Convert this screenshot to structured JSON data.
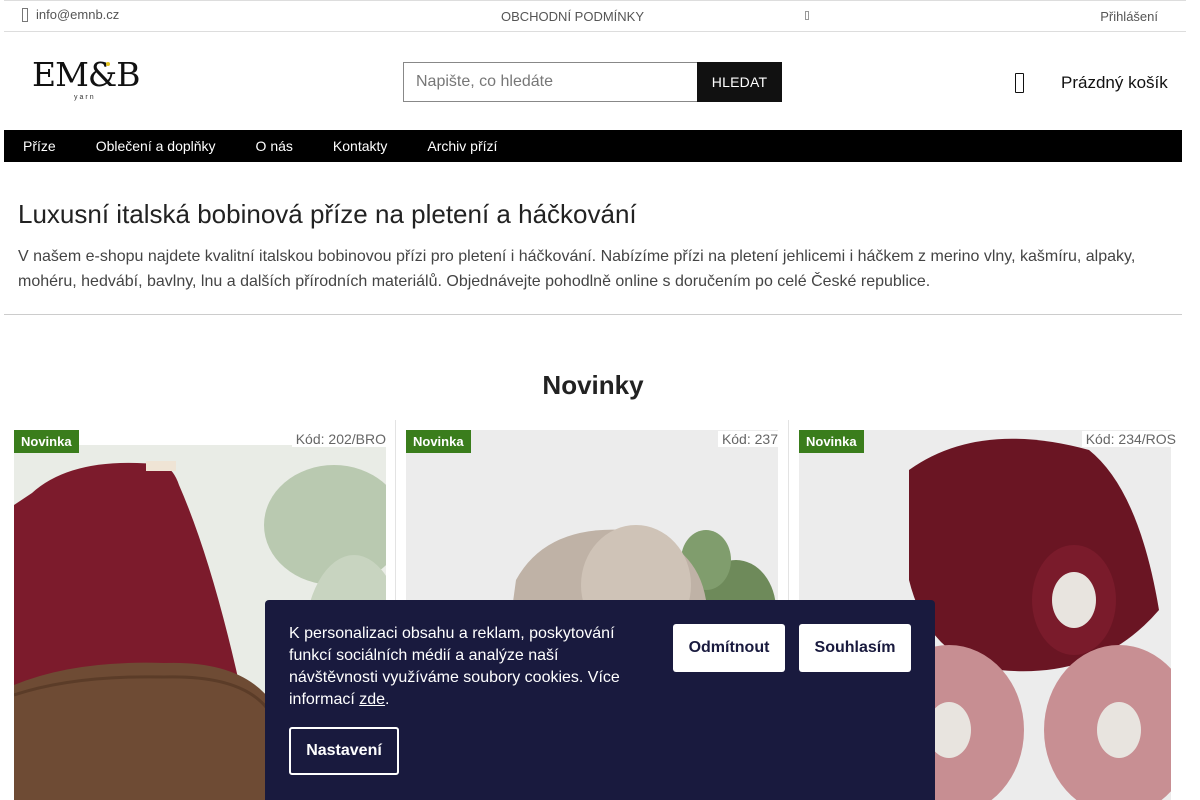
{
  "topbar": {
    "email": "info@emnb.cz",
    "terms": "OBCHODNÍ PODMÍNKY",
    "login": "Přihlášení"
  },
  "logo": {
    "text": "EM&B",
    "subtitle": "yarn"
  },
  "search": {
    "placeholder": "Napište, co hledáte",
    "value": "",
    "button": "HLEDAT"
  },
  "cart": {
    "label": "Prázdný košík",
    "icon": "cart-icon"
  },
  "nav": {
    "items": [
      "Příze",
      "Oblečení a doplňky",
      "O nás",
      "Kontakty",
      "Archiv přízí"
    ]
  },
  "intro": {
    "title": "Luxusní italská bobinová příze na pletení a háčkování",
    "text": "V našem e-shopu najdete kvalitní italskou bobinovou přízi pro pletení i háčkování. Nabízíme přízi na pletení jehlicemi i háčkem z merino vlny, kašmíru, alpaky, mohéru, hedvábí, bavlny, lnu a dalších přírodních materiálů. Objednávejte pohodlně online s doručením po celé České republice."
  },
  "section": {
    "title": "Novinky"
  },
  "products": [
    {
      "badge": "Novinka",
      "code": "Kód: 202/BRO"
    },
    {
      "badge": "Novinka",
      "code": "Kód: 237"
    },
    {
      "badge": "Novinka",
      "code": "Kód: 234/ROS"
    }
  ],
  "cookie": {
    "text": "K personalizaci obsahu a reklam, poskytování funkcí sociálních médií a analýze naší návštěvnosti využíváme soubory cookies. Více informací",
    "link": "zde",
    "period": ".",
    "decline": "Odmítnout",
    "accept": "Souhlasím",
    "settings": "Nastavení"
  },
  "colors": {
    "nav_bg": "#000000",
    "badge": "#3a7d1c",
    "cookie_bg": "#191a3e",
    "logo_dot": "#e5c41d"
  }
}
